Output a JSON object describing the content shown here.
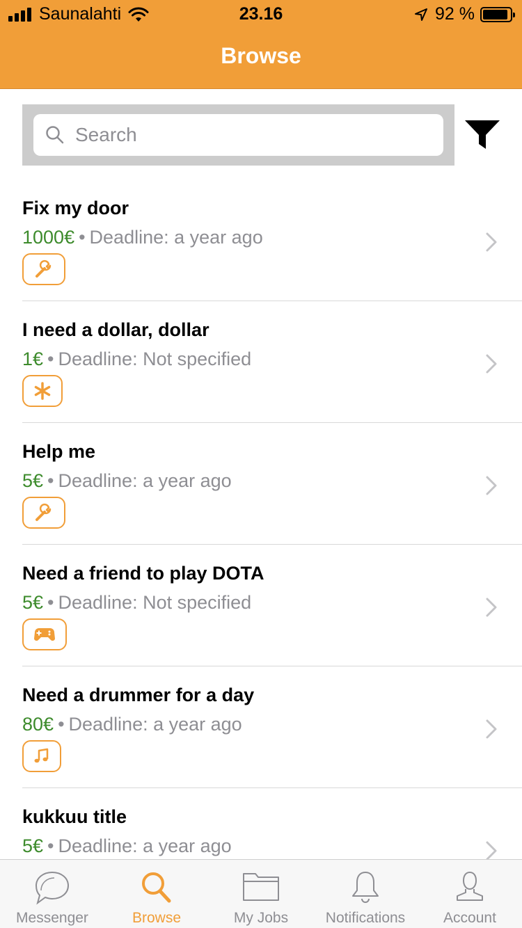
{
  "status_bar": {
    "carrier": "Saunalahti",
    "time": "23.16",
    "battery_percent": "92 %",
    "battery_level": 0.92
  },
  "header": {
    "title": "Browse"
  },
  "search": {
    "placeholder": "Search",
    "value": ""
  },
  "jobs": [
    {
      "title": "Fix my door",
      "price": "1000€",
      "separator": "•",
      "deadline": "Deadline: a year ago",
      "category_icon": "wrench-icon"
    },
    {
      "title": "I need a dollar, dollar",
      "price": "1€",
      "separator": "•",
      "deadline": "Deadline: Not specified",
      "category_icon": "asterisk-icon"
    },
    {
      "title": "Help me",
      "price": "5€",
      "separator": "•",
      "deadline": "Deadline: a year ago",
      "category_icon": "wrench-icon"
    },
    {
      "title": "Need a friend to play DOTA",
      "price": "5€",
      "separator": "•",
      "deadline": "Deadline: Not specified",
      "category_icon": "gamepad-icon"
    },
    {
      "title": "Need a drummer for a day",
      "price": "80€",
      "separator": "•",
      "deadline": "Deadline: a year ago",
      "category_icon": "music-note-icon"
    },
    {
      "title": "kukkuu title",
      "price": "5€",
      "separator": "•",
      "deadline": "Deadline: a year ago",
      "category_icon": ""
    }
  ],
  "tabs": [
    {
      "label": "Messenger",
      "icon": "chat-bubble-icon",
      "active": false
    },
    {
      "label": "Browse",
      "icon": "search-icon",
      "active": true
    },
    {
      "label": "My Jobs",
      "icon": "folder-icon",
      "active": false
    },
    {
      "label": "Notifications",
      "icon": "bell-icon",
      "active": false
    },
    {
      "label": "Account",
      "icon": "person-icon",
      "active": false
    }
  ],
  "colors": {
    "accent": "#F19E38",
    "price": "#3d8b2c",
    "secondary_text": "#8e8e93",
    "search_bar_bg": "#cccccc"
  }
}
